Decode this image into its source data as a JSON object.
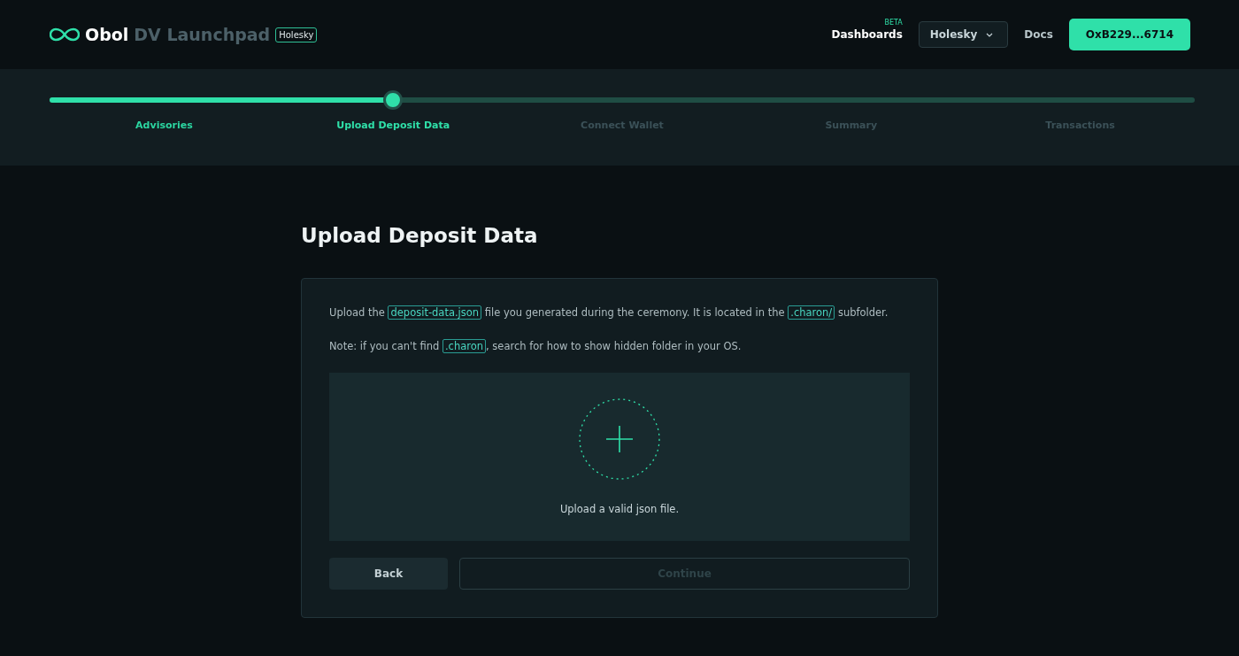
{
  "header": {
    "brand": "Obol",
    "product": "DV Launchpad",
    "network_badge": "Holesky",
    "nav": [
      {
        "label": "Dashboards",
        "badge": "BETA"
      },
      {
        "label": "Docs"
      }
    ],
    "network_select": "Holesky",
    "wallet_button": "OxB229...6714"
  },
  "stepper": {
    "level": 0.3,
    "steps": [
      {
        "label": "Advisories",
        "completed": true,
        "selected": false
      },
      {
        "label": "Upload Deposit Data",
        "completed": false,
        "selected": true
      },
      {
        "label": "Connect Wallet",
        "completed": false,
        "selected": false
      },
      {
        "label": "Summary",
        "completed": false,
        "selected": false
      },
      {
        "label": "Transactions",
        "completed": false,
        "selected": false
      }
    ]
  },
  "title": "Upload Deposit Data",
  "instructions": [
    [
      {
        "kind": "text",
        "text": "Upload the "
      },
      {
        "kind": "code",
        "text": "deposit-data.json"
      },
      {
        "kind": "text",
        "text": " file you generated during the ceremony. It is located in the "
      },
      {
        "kind": "code",
        "text": ".charon/"
      },
      {
        "kind": "text",
        "text": " subfolder."
      }
    ],
    [
      {
        "kind": "text",
        "text": "Note: if you can't find "
      },
      {
        "kind": "code",
        "text": ".charon"
      },
      {
        "kind": "text",
        "text": ", search for how to show hidden folder in your OS."
      }
    ]
  ],
  "dropzone": {
    "hint": "Upload a valid json file."
  },
  "buttons": [
    {
      "label": "Back",
      "kind": "secondary",
      "disabled": false
    },
    {
      "label": "Continue",
      "kind": "primary",
      "disabled": true
    }
  ]
}
